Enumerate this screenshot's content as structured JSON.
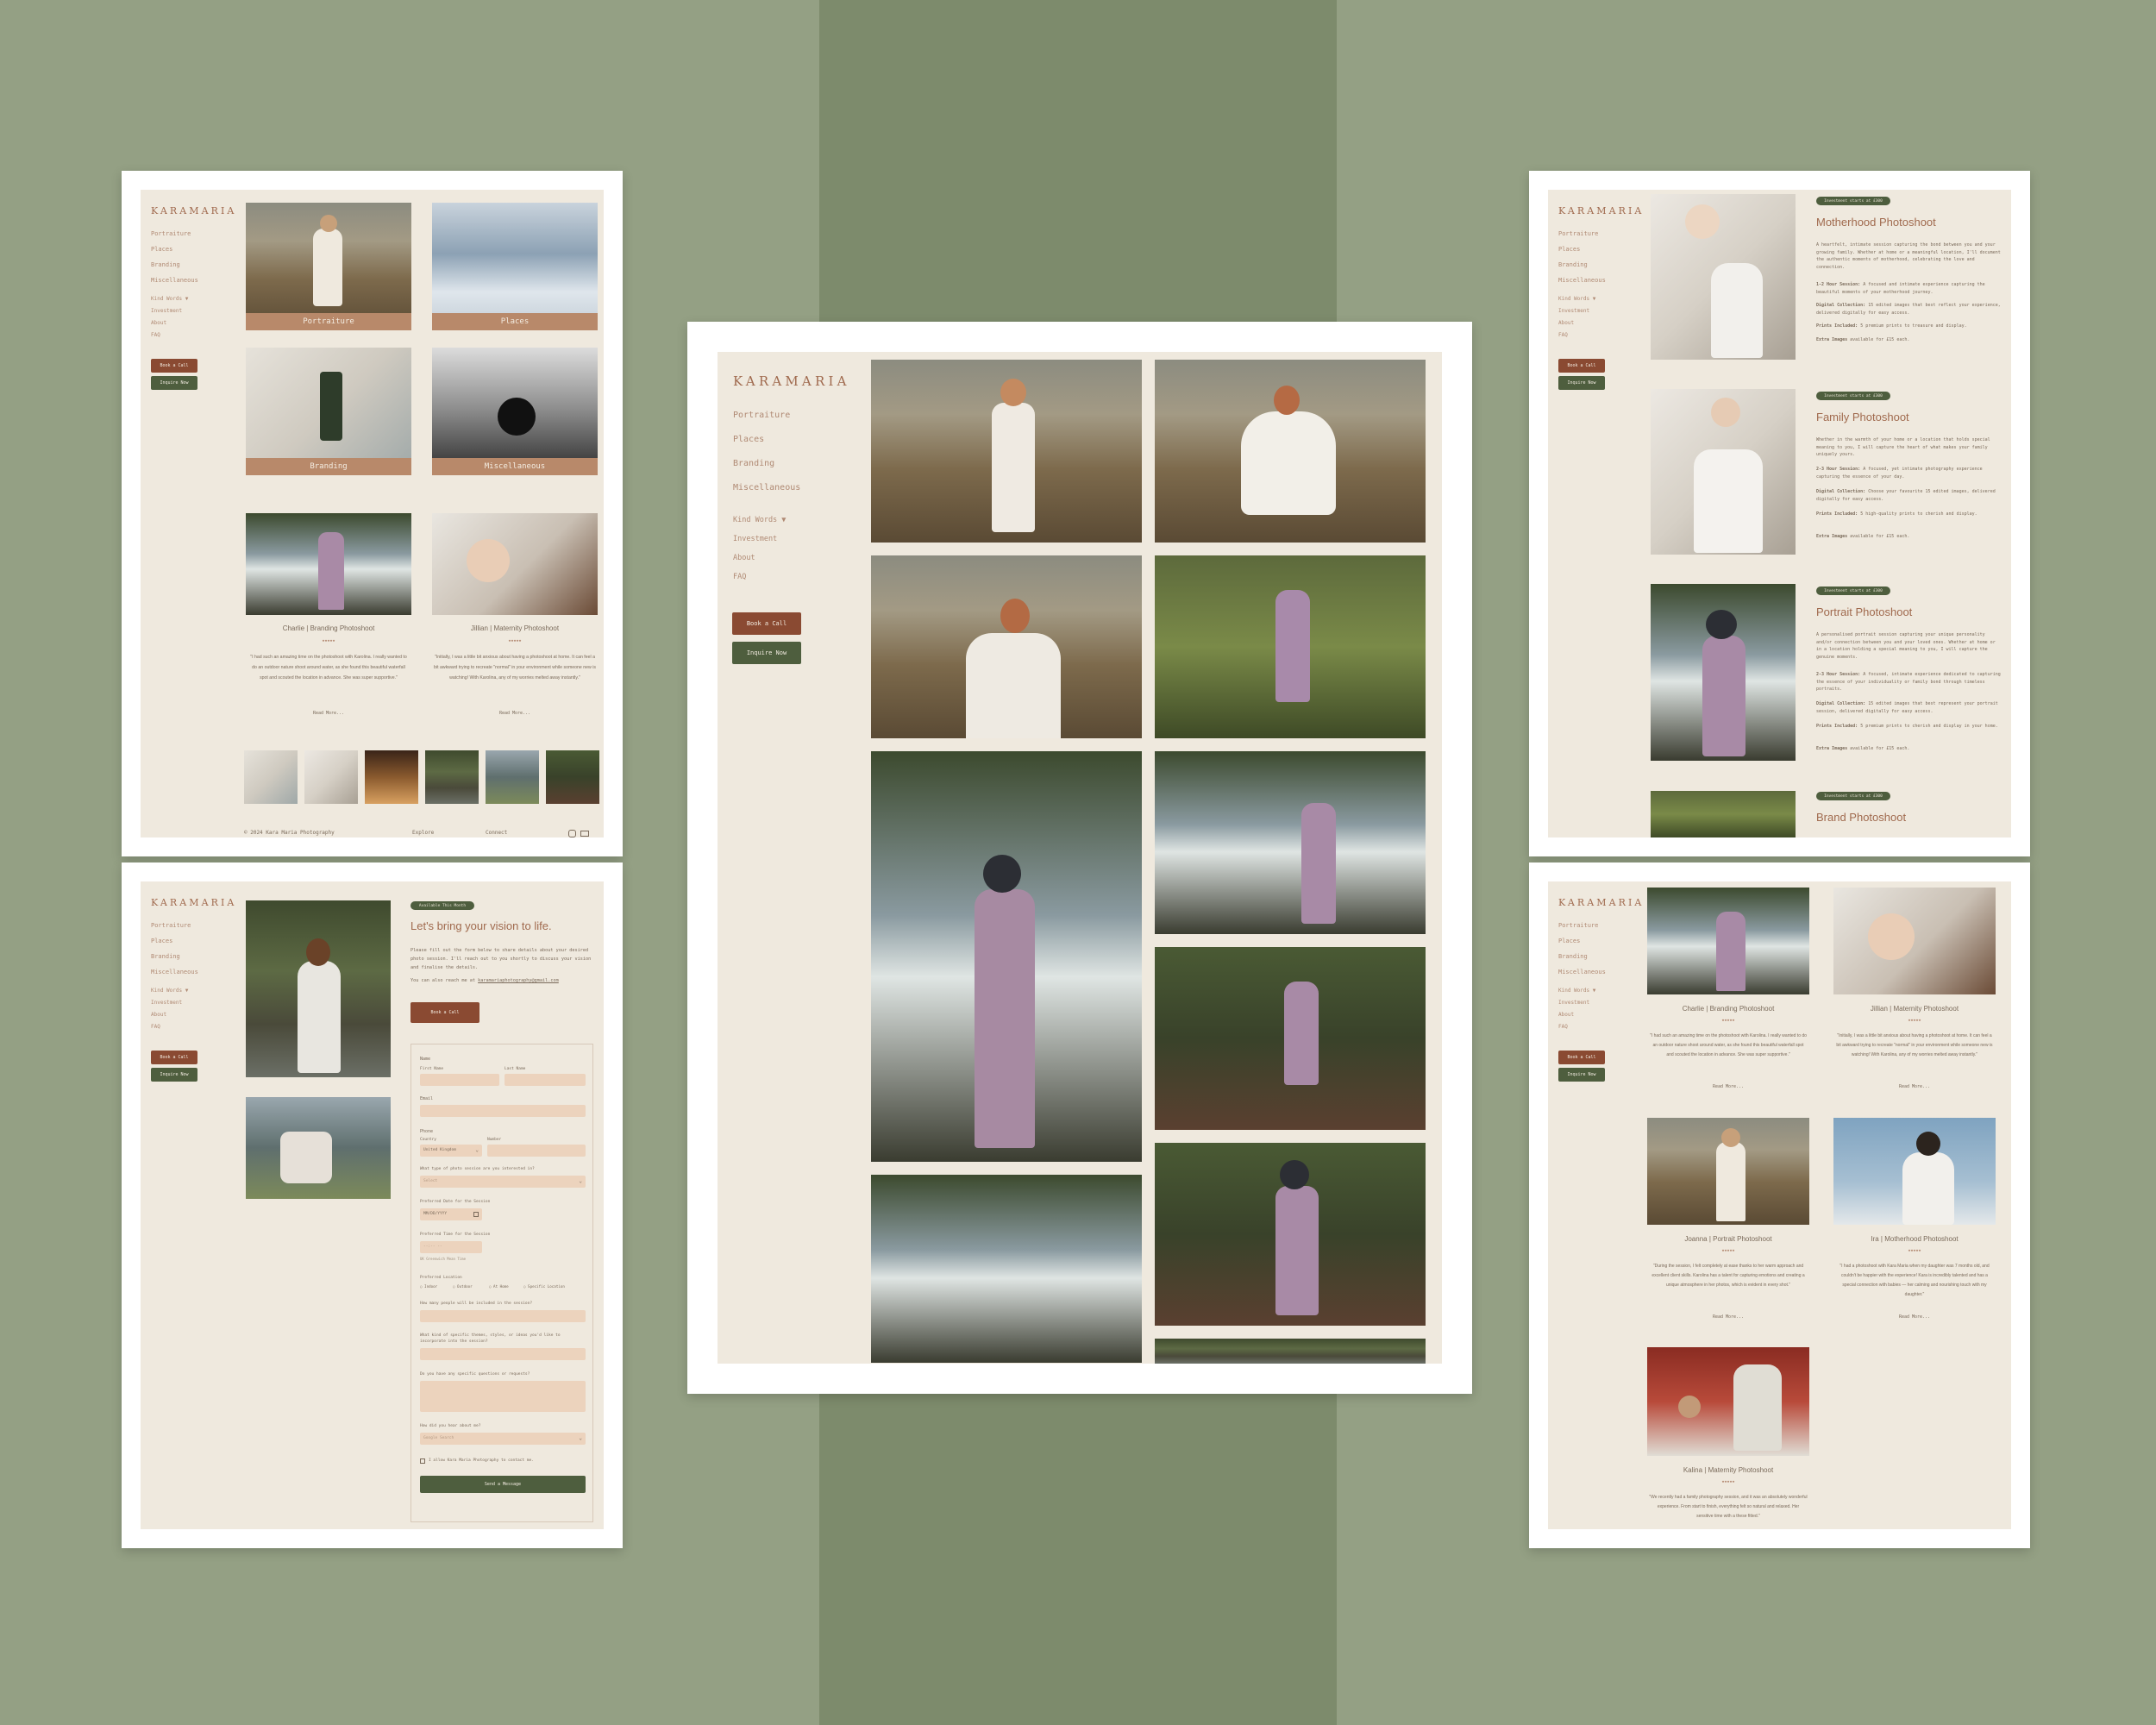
{
  "brand": {
    "logo": "KARAMARIA"
  },
  "nav": {
    "primary": [
      "Portraiture",
      "Places",
      "Branding",
      "Miscellaneous"
    ],
    "secondary": [
      "Kind Words ▼",
      "Investment",
      "About",
      "FAQ"
    ]
  },
  "buttons": {
    "book": "Book a Call",
    "inquire": "Inquire Now"
  },
  "home": {
    "tiles": [
      "Portraiture",
      "Places",
      "Branding",
      "Miscellaneous"
    ],
    "testimonials": [
      {
        "title": "Charlie | Branding Photoshoot",
        "stars": "★★★★★",
        "quote": "\"I had such an amazing time on the photoshoot with Karolina. I really wanted to do an outdoor nature shoot around water, as she found this beautiful waterfall spot and scouted the location in advance. She was super supportive.\"",
        "more": "Read More..."
      },
      {
        "title": "Jillian | Maternity Photoshoot",
        "stars": "★★★★★",
        "quote": "\"Initially, I was a little bit anxious about having a photoshoot at home. It can feel a bit awkward trying to recreate \"normal\" in your environment while someone new is watching! With Karolina, any of my worries melted away instantly.\"",
        "more": "Read More..."
      }
    ],
    "footer": {
      "copy": "© 2024 Kara Maria Photography",
      "explore": "Explore",
      "connect": "Connect"
    }
  },
  "contact": {
    "badge": "Available This Month",
    "heading": "Let's bring your vision to life.",
    "intro": "Please fill out the form below to share details about your desired photo session. I'll reach out to you shortly to discuss your vision and finalise the details.",
    "also": "You can also reach me at",
    "email": "karamariaphotography@gmail.com",
    "book": "Book a Call",
    "form": {
      "name": "Name",
      "first": "First Name",
      "last": "Last Name",
      "email": "Email",
      "phone": "Phone",
      "country": "Country",
      "number": "Number",
      "country_value": "United Kingdom",
      "session_q": "What type of photo session are you interested in?",
      "select": "Select",
      "date_q": "Preferred Date for the Session",
      "date_ph": "MM/DD/YYYY",
      "time_q": "Preferred Time for the Session",
      "time_ph": "--:-- --",
      "tz": "UK Greenwich Mean Time",
      "loc_q": "Preferred Location",
      "loc_opts": [
        "Indoor",
        "Outdoor",
        "At Home",
        "Specific Location"
      ],
      "people_q": "How many people will be included in the session?",
      "themes_q": "What kind of specific themes, styles, or ideas you'd like to incorporate into the session?",
      "questions_q": "Do you have any specific questions or requests?",
      "heard_q": "How did you hear about me?",
      "heard_ph": "Google Search",
      "consent": "I allow Kara Maria Photography to contact me.",
      "send": "Send a Message"
    }
  },
  "investment": {
    "services": [
      {
        "pill": "Investment starts at £300",
        "title": "Motherhood Photoshoot",
        "desc": "A heartfelt, intimate session capturing the bond between you and your growing family. Whether at home or a meaningful location, I'll document the authentic moments of motherhood, celebrating the love and connection.",
        "l1": "1-2 Hour Session:",
        "t1": "A focused and intimate experience capturing the beautiful moments of your motherhood journey.",
        "l2": "Digital Collection:",
        "t2": "15 edited images that best reflect your experience, delivered digitally for easy access.",
        "l3": "Prints Included:",
        "t3": "5 premium prints to treasure and display.",
        "l4": "Extra Images",
        "t4": "available for £15 each."
      },
      {
        "pill": "Investment starts at £300",
        "title": "Family Photoshoot",
        "desc": "Whether in the warmth of your home or a location that holds special meaning to you, I will capture the heart of what makes your family uniquely yours.",
        "l1": "2-3 Hour Session:",
        "t1": "A focused, yet intimate photography experience capturing the essence of your day.",
        "l2": "Digital Collection:",
        "t2": "Choose your favourite 15 edited images, delivered digitally for easy access.",
        "l3": "Prints Included:",
        "t3": "5 high-quality prints to cherish and display.",
        "l4": "Extra Images",
        "t4": "available for £15 each."
      },
      {
        "pill": "Investment starts at £300",
        "title": "Portrait Photoshoot",
        "desc": "A personalised portrait session capturing your unique personality and/or connection between you and your loved ones. Whether at home or in a location holding a special meaning to you, I will capture the genuine moments.",
        "l1": "2-3 Hour Session:",
        "t1": "A focused, intimate experience dedicated to capturing the essence of your individuality or family bond through timeless portraits.",
        "l2": "Digital Collection:",
        "t2": "15 edited images that best represent your portrait session, delivered digitally for easy access.",
        "l3": "Prints Included:",
        "t3": "5 premium prints to cherish and display in your home.",
        "l4": "Extra Images",
        "t4": "available for £15 each."
      },
      {
        "pill": "Investment starts at £300",
        "title": "Brand Photoshoot"
      }
    ]
  },
  "kindwords": {
    "items": [
      {
        "title": "Charlie | Branding Photoshoot",
        "stars": "★★★★★",
        "quote": "\"I had such an amazing time on the photoshoot with Karolina. I really wanted to do an outdoor nature shoot around water, as she found this beautiful waterfall spot and scouted the location in advance. She was super supportive.\"",
        "more": "Read More..."
      },
      {
        "title": "Jillian | Maternity Photoshoot",
        "stars": "★★★★★",
        "quote": "\"Initially, I was a little bit anxious about having a photoshoot at home. It can feel a bit awkward trying to recreate \"normal\" in your environment while someone new is watching! With Karolina, any of my worries melted away instantly.\"",
        "more": "Read More..."
      },
      {
        "title": "Joanna | Portrait Photoshoot",
        "stars": "★★★★★",
        "quote": "\"During the session, I felt completely at ease thanks to her warm approach and excellent client skills. Karolina has a talent for capturing emotions and creating a unique atmosphere in her photos, which is evident in every shot.\"",
        "more": "Read More..."
      },
      {
        "title": "Ira | Motherhood Photoshoot",
        "stars": "★★★★★",
        "quote": "\"I had a photoshoot with Kara Maria when my daughter was 7 months old, and couldn't be happier with the experience! Kara is incredibly talented and has a special connection with babies — her calming and nourishing touch with my daughter.\"",
        "more": "Read More..."
      },
      {
        "title": "Kalina | Maternity Photoshoot",
        "stars": "★★★★★",
        "quote": "\"We recently had a family photography session, and it was an absolutely wonderful experience. From start to finish, everything felt so natural and relaxed. Her sensitive time with a these fitted.\""
      }
    ]
  }
}
